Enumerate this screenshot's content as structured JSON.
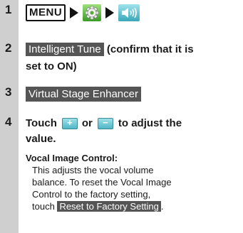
{
  "steps": [
    {
      "num": "1",
      "menu_label": "MENU",
      "icons": [
        "gear-icon",
        "speaker-icon"
      ]
    },
    {
      "num": "2",
      "button": "Intelligent Tune",
      "text_line1": " (confirm that it is",
      "text_line2": "set to ON)"
    },
    {
      "num": "3",
      "button": "Virtual Stage Enhancer"
    },
    {
      "num": "4",
      "touch": "Touch",
      "or": "or",
      "line1_end": "to adjust the",
      "line2": "value."
    }
  ],
  "note": {
    "title": "Vocal Image Control:",
    "lines": [
      "This adjusts the vocal volume",
      "balance. To reset the Vocal Image",
      "Control to the factory setting,"
    ],
    "touch": "touch",
    "reset_button": "Reset to Factory Setting",
    "period": "."
  },
  "colors": {
    "rail": "#cfcfcf",
    "button_dark": "#555555",
    "mini_button": "#4fb6c6"
  }
}
